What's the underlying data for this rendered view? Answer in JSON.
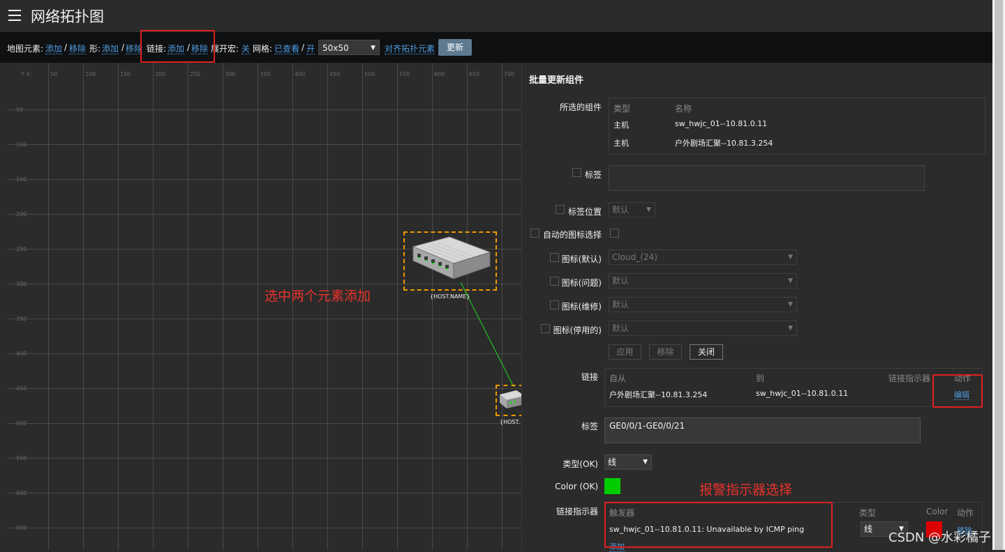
{
  "header": {
    "title": "网络拓扑图"
  },
  "toolbar": {
    "map_elements_label": "地图元素:",
    "add": "添加",
    "remove": "移除",
    "shapes_label": "形:",
    "links_label": "链接:",
    "expand_macros_label": "展开宏:",
    "expand_macros_value": "关",
    "grid_label": "网格:",
    "grid_shown": "已查看",
    "grid_on": "开",
    "grid_size": "50x50",
    "align_elements": "对齐拓扑元素",
    "update_button": "更新"
  },
  "canvas": {
    "x_axis_title": "Y X:",
    "x_ticks": [
      "50",
      "100",
      "150",
      "200",
      "250",
      "300",
      "350",
      "400",
      "450",
      "500",
      "550",
      "600",
      "650",
      "700"
    ],
    "y_ticks": [
      "50",
      "100",
      "150",
      "200",
      "250",
      "300",
      "350",
      "400",
      "450",
      "500",
      "550",
      "600",
      "650"
    ],
    "host1_label": "{HOST.NAME}",
    "host2_label": "{HOST.",
    "annotation_add": "选中两个元素添加"
  },
  "panel": {
    "title": "批量更新组件",
    "selected_label": "所选的组件",
    "selected_headers": {
      "type": "类型",
      "name": "名称"
    },
    "selected_rows": [
      {
        "type": "主机",
        "name": "sw_hwjc_01--10.81.0.11"
      },
      {
        "type": "主机",
        "name": "户外剧场汇聚--10.81.3.254"
      }
    ],
    "label_label": "标签",
    "label_location_label": "标签位置",
    "label_location_value": "默认",
    "auto_icon_label": "自动的图标选择",
    "icon_default_label": "图标(默认)",
    "icon_default_value": "Cloud_(24)",
    "icon_problem_label": "图标(问题)",
    "icon_problem_value": "默认",
    "icon_maintenance_label": "图标(维修)",
    "icon_maintenance_value": "默认",
    "icon_disabled_label": "图标(停用的)",
    "icon_disabled_value": "默认",
    "apply_button": "应用",
    "remove_button": "移除",
    "close_button": "关闭",
    "links_label": "链接",
    "links_headers": {
      "from": "自从",
      "to": "到",
      "indicators": "链接指示器",
      "action": "动作"
    },
    "link_row": {
      "from": "户外剧场汇聚--10.81.3.254",
      "to": "sw_hwjc_01--10.81.0.11",
      "action": "编辑"
    },
    "link_label_label": "标签",
    "link_label_value": "GE0/0/1-GE0/0/21",
    "type_ok_label": "类型(OK)",
    "type_ok_value": "线",
    "color_ok_label": "Color (OK)",
    "color_ok_value": "#00cc00",
    "annotation_indicator": "报警指示器选择",
    "indicators_label": "链接指示器",
    "indicators_headers": {
      "trigger": "触发器",
      "type": "类型",
      "color": "Color",
      "action": "动作"
    },
    "indicator_row": {
      "trigger": "sw_hwjc_01--10.81.0.11: Unavailable by ICMP ping",
      "type": "线",
      "color": "#dd0000",
      "action": "移除"
    },
    "add_link": "添加"
  },
  "watermark": "CSDN @水彩橘子"
}
